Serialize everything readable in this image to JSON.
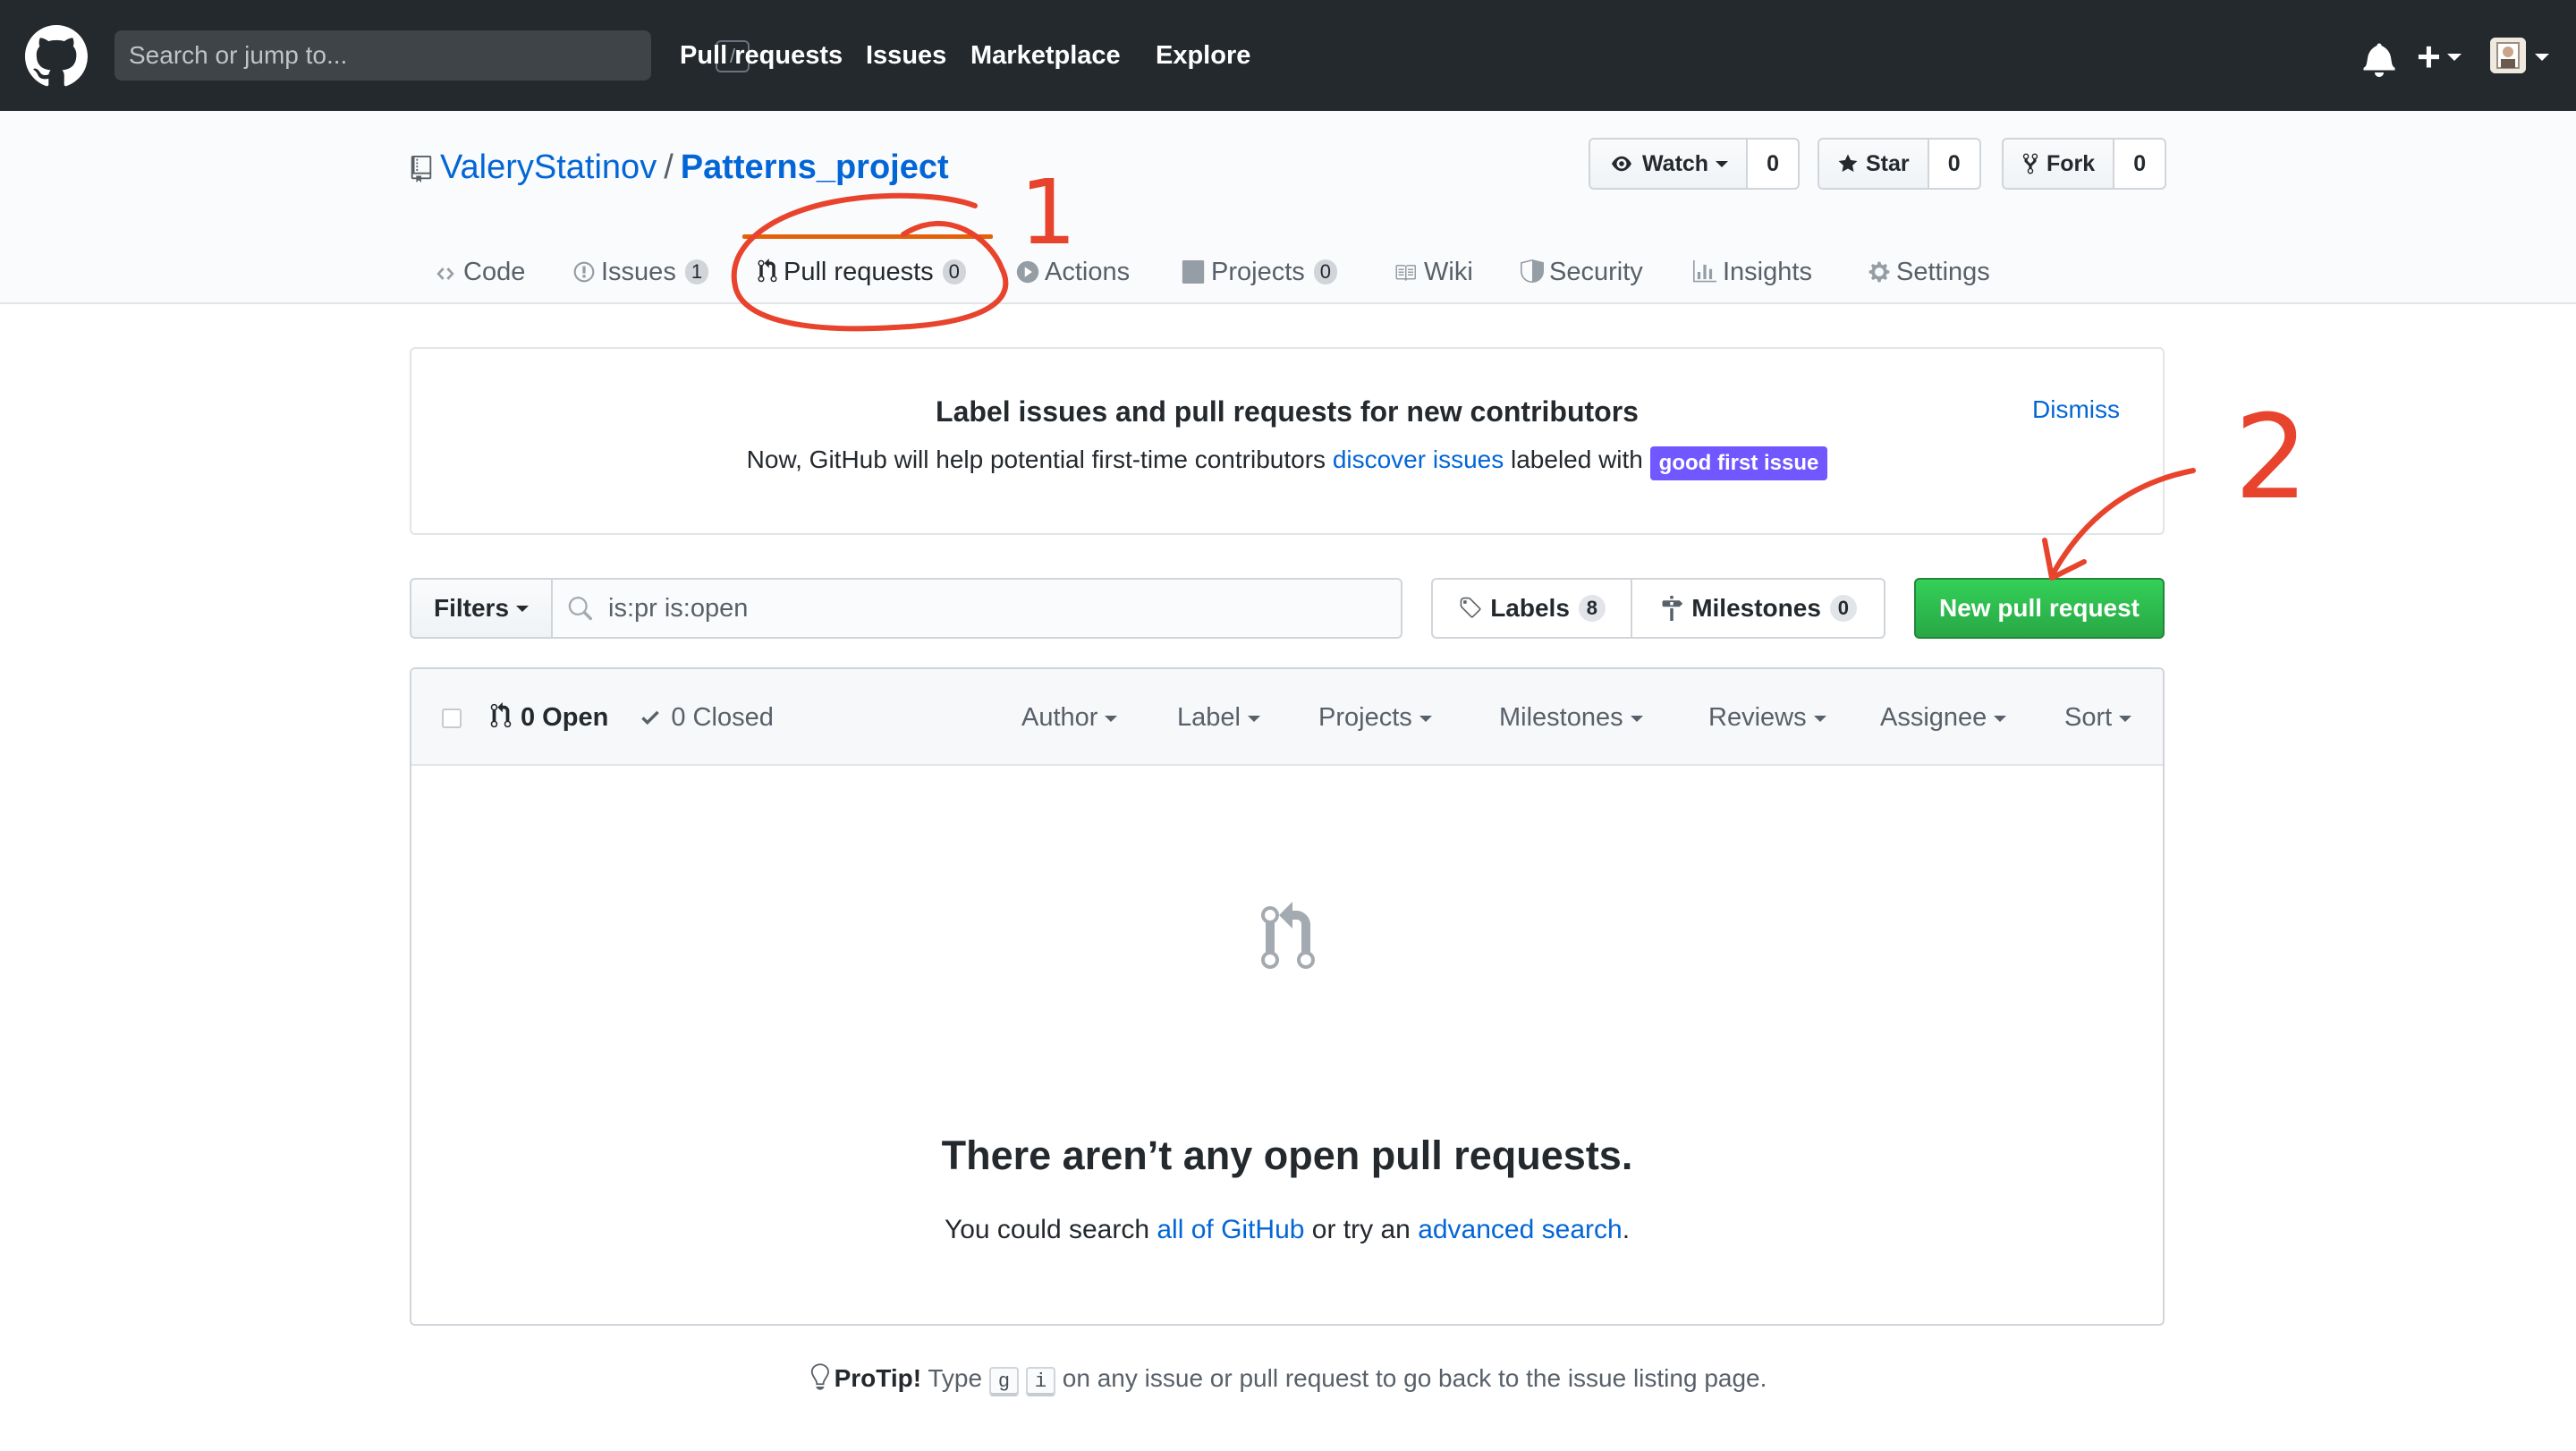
{
  "header": {
    "search_placeholder": "Search or jump to...",
    "search_shortcut": "/",
    "nav": [
      "Pull requests",
      "Issues",
      "Marketplace",
      "Explore"
    ],
    "plus_symbol": "+"
  },
  "repo": {
    "owner": "ValeryStatinov",
    "separator": "/",
    "name": "Patterns_project",
    "actions": [
      {
        "label": "Watch",
        "count": "0"
      },
      {
        "label": "Star",
        "count": "0"
      },
      {
        "label": "Fork",
        "count": "0"
      }
    ],
    "tabs": [
      {
        "label": "Code",
        "icon": "code-icon"
      },
      {
        "label": "Issues",
        "count": "1",
        "icon": "issue-icon"
      },
      {
        "label": "Pull requests",
        "count": "0",
        "icon": "pull-request-icon",
        "selected": true
      },
      {
        "label": "Actions",
        "icon": "play-icon"
      },
      {
        "label": "Projects",
        "count": "0",
        "icon": "project-icon"
      },
      {
        "label": "Wiki",
        "icon": "book-icon"
      },
      {
        "label": "Security",
        "icon": "shield-icon"
      },
      {
        "label": "Insights",
        "icon": "graph-icon"
      },
      {
        "label": "Settings",
        "icon": "gear-icon"
      }
    ]
  },
  "banner": {
    "title": "Label issues and pull requests for new contributors",
    "text_before": "Now, GitHub will help potential first-time contributors",
    "link": "discover issues",
    "text_after": "labeled with",
    "label": "good first issue",
    "label_color": "#7057ff",
    "dismiss": "Dismiss"
  },
  "filters": {
    "button": "Filters",
    "query": "is:pr is:open",
    "labels": {
      "label": "Labels",
      "count": "8"
    },
    "milestones": {
      "label": "Milestones",
      "count": "0"
    },
    "new_pr": "New pull request",
    "new_pr_color": "#28a745"
  },
  "list": {
    "open": "0 Open",
    "closed": "0 Closed",
    "selects": [
      "Author",
      "Label",
      "Projects",
      "Milestones",
      "Reviews",
      "Assignee",
      "Sort"
    ],
    "blank_title": "There aren’t any open pull requests.",
    "blank_prefix": "You could search",
    "blank_link1": "all of GitHub",
    "blank_mid": "or try an",
    "blank_link2": "advanced search",
    "blank_suffix": "."
  },
  "protip": {
    "strong": "ProTip!",
    "text1": "Type",
    "key1": "g",
    "key2": "i",
    "text2": "on any issue or pull request to go back to the issue listing page."
  },
  "annotations": {
    "mark1": "1",
    "mark2": "2",
    "color": "#e8432c"
  }
}
